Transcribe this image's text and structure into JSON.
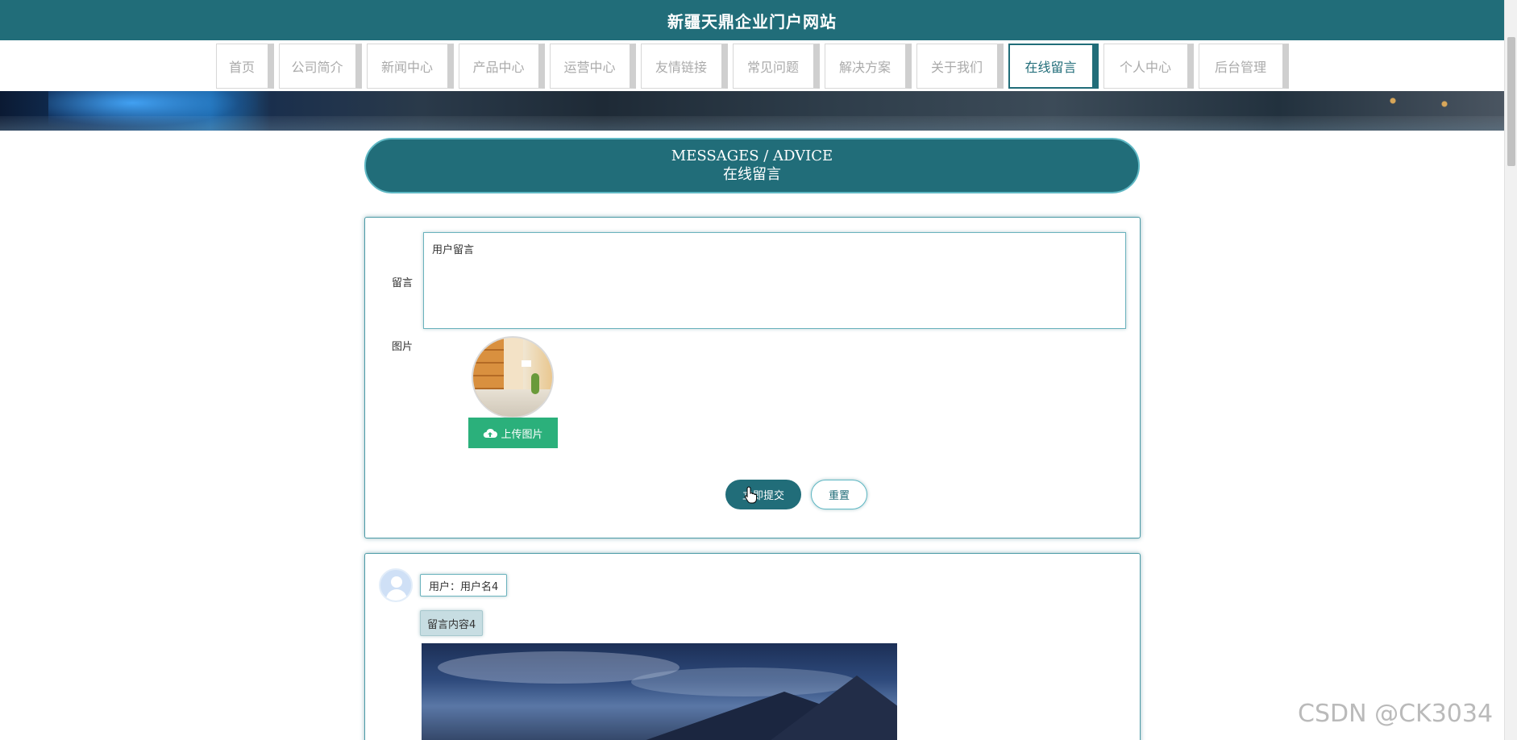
{
  "header": {
    "title": "新疆天鼎企业门户网站"
  },
  "nav": {
    "items": [
      {
        "label": "首页"
      },
      {
        "label": "公司简介"
      },
      {
        "label": "新闻中心"
      },
      {
        "label": "产品中心"
      },
      {
        "label": "运营中心"
      },
      {
        "label": "友情链接"
      },
      {
        "label": "常见问题"
      },
      {
        "label": "解决方案"
      },
      {
        "label": "关于我们"
      },
      {
        "label": "在线留言",
        "active": true
      },
      {
        "label": "个人中心"
      },
      {
        "label": "后台管理"
      }
    ]
  },
  "section": {
    "title_en": "MESSAGES / ADVICE",
    "title_cn": "在线留言"
  },
  "form": {
    "message_label": "留言",
    "message_value": "用户留言",
    "image_label": "图片",
    "upload_label": "上传图片",
    "submit_label": "立即提交",
    "reset_label": "重置"
  },
  "messages": [
    {
      "user": "用户：用户名4",
      "content": "留言内容4"
    }
  ],
  "watermark": "CSDN @CK3034",
  "colors": {
    "primary": "#216d79",
    "upload": "#2bb07b"
  }
}
